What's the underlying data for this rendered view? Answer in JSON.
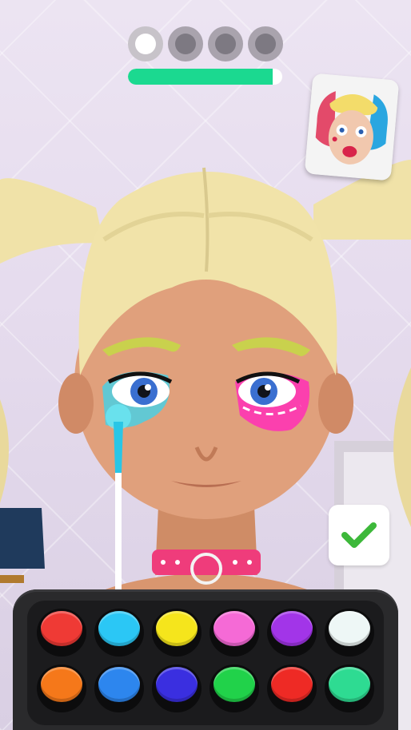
{
  "level_progress": {
    "stages_total": 4,
    "stages_completed": 1,
    "bar_fill_fraction": 0.94,
    "bar_color": "#1bd990"
  },
  "reference_card": {
    "icon": "target-look-portrait-icon"
  },
  "confirm": {
    "icon": "checkmark-icon",
    "color": "#3db83a"
  },
  "palette": {
    "colors": [
      {
        "name": "red",
        "hex": "#ef3a35"
      },
      {
        "name": "sky-blue",
        "hex": "#2bc7f5"
      },
      {
        "name": "yellow",
        "hex": "#f5e51c"
      },
      {
        "name": "pink",
        "hex": "#f56ad6"
      },
      {
        "name": "purple",
        "hex": "#a235e8"
      },
      {
        "name": "white",
        "hex": "#eef7f6"
      },
      {
        "name": "orange",
        "hex": "#f5781a"
      },
      {
        "name": "blue",
        "hex": "#2d86ee"
      },
      {
        "name": "indigo",
        "hex": "#3a2fe0"
      },
      {
        "name": "green",
        "hex": "#21d24a"
      },
      {
        "name": "red-2",
        "hex": "#ee2a25"
      },
      {
        "name": "mint",
        "hex": "#2edb92"
      }
    ]
  },
  "tool": {
    "icon": "makeup-brush-icon"
  }
}
